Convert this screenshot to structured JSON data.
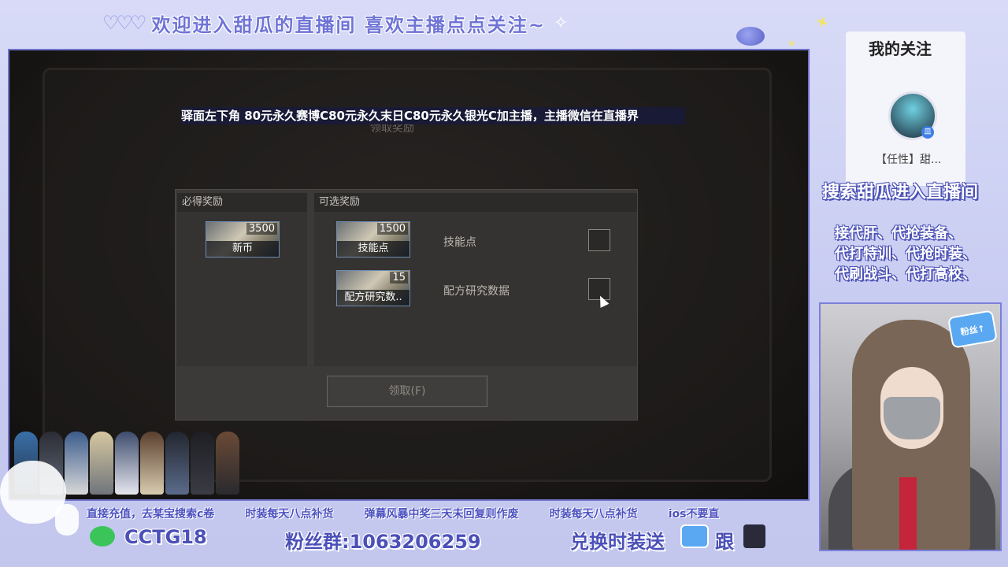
{
  "overlay": {
    "top_banner": "欢迎进入甜瓜的直播间 喜欢主播点点关注~",
    "ticker": "驿面左下角 80元永久赛博C80元永久末日C80元永久银光C加主播，主播微信在直播界",
    "colors": {
      "accent": "#6f74d6",
      "frame": "#c9cdf0"
    }
  },
  "game": {
    "dialog_title": "领取奖励",
    "required_header": "必得奖励",
    "optional_header": "可选奖励",
    "required_items": [
      {
        "count": "3500",
        "name": "新币"
      }
    ],
    "optional_items": [
      {
        "count": "1500",
        "name": "技能点",
        "label": "技能点",
        "checked": false
      },
      {
        "count": "15",
        "name": "配方研究数..",
        "label": "配方研究数据",
        "checked": false
      }
    ],
    "claim_button": "领取(F)"
  },
  "sidebar": {
    "follow_title": "我的关注",
    "follow_name": "【任性】甜...",
    "avatar_badge": "皿",
    "search_banner": "搜索甜瓜进入直播间",
    "service_lines": [
      "接代肝、代抢装备、",
      "代打特训、代抢时装、",
      "代刷战斗、代打高校、"
    ],
    "fan_badge": "粉丝↑"
  },
  "bottom": {
    "marquee": [
      "直接充值，去某宝搜索c卷",
      "时装每天八点补货",
      "弹幕风暴中奖三天未回复则作废",
      "时装每天八点补货",
      "ios不要直"
    ],
    "wechat_id": "CCTG18",
    "fan_group": "粉丝群:1063206259",
    "exchange": "兑换时装送",
    "follow": "跟"
  }
}
